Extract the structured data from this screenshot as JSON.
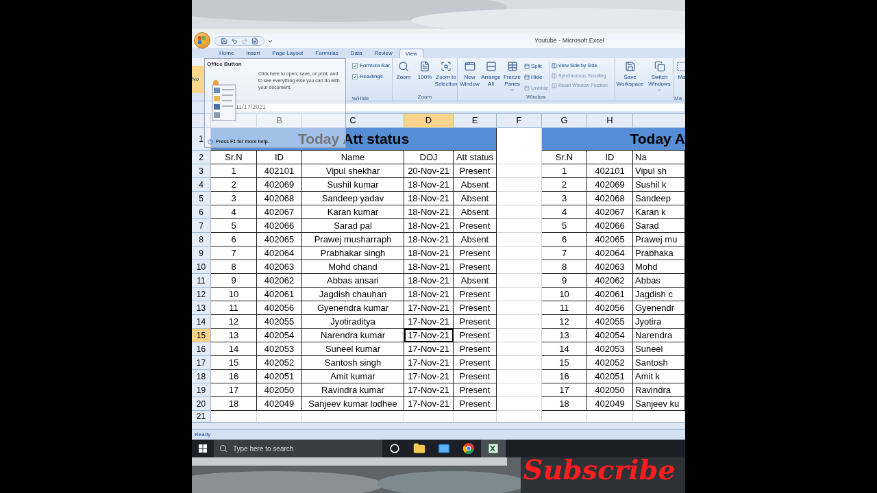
{
  "window": {
    "title": "Youtube - Microsoft Excel"
  },
  "tabs": [
    {
      "label": "Home",
      "selected": false
    },
    {
      "label": "Insert",
      "selected": false
    },
    {
      "label": "Page Layout",
      "selected": false
    },
    {
      "label": "Formulas",
      "selected": false
    },
    {
      "label": "Data",
      "selected": false
    },
    {
      "label": "Review",
      "selected": false
    },
    {
      "label": "View",
      "selected": true
    }
  ],
  "ribbon": {
    "workbook_views": {
      "button": "No"
    },
    "show_hide": {
      "label": "w/Hide",
      "checkboxes": [
        {
          "label": "Formula Bar",
          "checked": true
        },
        {
          "label": "Headings",
          "checked": true
        }
      ]
    },
    "zoom": {
      "label": "Zoom",
      "buttons": [
        "Zoom",
        "100%",
        "Zoom to Selection"
      ]
    },
    "window_group": {
      "label": "Window",
      "large_buttons": [
        {
          "label": "New Window",
          "dropdown": false
        },
        {
          "label": "Arrange All",
          "dropdown": false
        },
        {
          "label": "Freeze Panes",
          "dropdown": true
        }
      ],
      "small_buttons": [
        {
          "label": "Split",
          "disabled": false
        },
        {
          "label": "Hide",
          "disabled": false
        },
        {
          "label": "Unhide",
          "disabled": true
        }
      ],
      "side_buttons": [
        {
          "label": "View Side by Side",
          "disabled": false
        },
        {
          "label": "Synchronous Scrolling",
          "disabled": true
        },
        {
          "label": "Reset Window Position",
          "disabled": true
        }
      ],
      "large_buttons_2": [
        {
          "label": "Save Workspace",
          "dropdown": false
        },
        {
          "label": "Switch Windows",
          "dropdown": true
        }
      ]
    },
    "macros_group": {
      "button": "Ma",
      "label": "Ma"
    }
  },
  "tooltip": {
    "title": "Office Button",
    "text": "Click here to open, save, or print, and to see everything else you can do with your document.",
    "help": "Press F1 for more help."
  },
  "formula_bar": {
    "value": "11/17/2021"
  },
  "columns": [
    {
      "label": "B",
      "selected": false
    },
    {
      "label": "C",
      "selected": false
    },
    {
      "label": "D",
      "selected": true
    },
    {
      "label": "E",
      "selected": false
    },
    {
      "label": "F",
      "selected": false
    },
    {
      "label": "G",
      "selected": false
    },
    {
      "label": "H",
      "selected": false
    }
  ],
  "row_headers": [
    {
      "label": "1",
      "selected": false
    },
    {
      "label": "2",
      "selected": false
    },
    {
      "label": "3",
      "selected": false
    },
    {
      "label": "4",
      "selected": false
    },
    {
      "label": "5",
      "selected": false
    },
    {
      "label": "6",
      "selected": false
    },
    {
      "label": "7",
      "selected": false
    },
    {
      "label": "8",
      "selected": false
    },
    {
      "label": "9",
      "selected": false
    },
    {
      "label": "10",
      "selected": false
    },
    {
      "label": "11",
      "selected": false
    },
    {
      "label": "12",
      "selected": false
    },
    {
      "label": "13",
      "selected": false
    },
    {
      "label": "14",
      "selected": false
    },
    {
      "label": "15",
      "selected": true
    },
    {
      "label": "16",
      "selected": false
    },
    {
      "label": "17",
      "selected": false
    },
    {
      "label": "18",
      "selected": false
    },
    {
      "label": "19",
      "selected": false
    },
    {
      "label": "20",
      "selected": false
    },
    {
      "label": "21",
      "selected": false
    }
  ],
  "left_table": {
    "title": "Today Att status",
    "headers": [
      "Sr.N",
      "ID",
      "Name",
      "DOJ",
      "Att status"
    ],
    "rows": [
      [
        "1",
        "402101",
        "Vipul shekhar",
        "20-Nov-21",
        "Present"
      ],
      [
        "2",
        "402069",
        "Sushil kumar",
        "18-Nov-21",
        "Absent"
      ],
      [
        "3",
        "402068",
        "Sandeep yadav",
        "18-Nov-21",
        "Absent"
      ],
      [
        "4",
        "402067",
        "Karan kumar",
        "18-Nov-21",
        "Absent"
      ],
      [
        "5",
        "402066",
        "Sarad pal",
        "18-Nov-21",
        "Present"
      ],
      [
        "6",
        "402065",
        "Prawej musharraph",
        "18-Nov-21",
        "Absent"
      ],
      [
        "7",
        "402064",
        "Prabhakar singh",
        "18-Nov-21",
        "Present"
      ],
      [
        "8",
        "402063",
        "Mohd chand",
        "18-Nov-21",
        "Present"
      ],
      [
        "9",
        "402062",
        "Abbas ansari",
        "18-Nov-21",
        "Absent"
      ],
      [
        "10",
        "402061",
        "Jagdish chauhan",
        "18-Nov-21",
        "Present"
      ],
      [
        "11",
        "402056",
        "Gyenendra kumar",
        "17-Nov-21",
        "Present"
      ],
      [
        "12",
        "402055",
        "Jyotiraditya",
        "17-Nov-21",
        "Present"
      ],
      [
        "13",
        "402054",
        "Narendra kumar",
        "17-Nov-21",
        "Present"
      ],
      [
        "14",
        "402053",
        "Suneel kumar",
        "17-Nov-21",
        "Present"
      ],
      [
        "15",
        "402052",
        "Santosh singh",
        "17-Nov-21",
        "Present"
      ],
      [
        "16",
        "402051",
        "Amit kumar",
        "17-Nov-21",
        "Present"
      ],
      [
        "17",
        "402050",
        "Ravindra kumar",
        "17-Nov-21",
        "Present"
      ],
      [
        "18",
        "402049",
        "Sanjeev kumar lodhee",
        "17-Nov-21",
        "Present"
      ]
    ]
  },
  "right_table": {
    "title": "Today A",
    "headers": [
      "Sr.N",
      "ID",
      "Na"
    ],
    "rows": [
      [
        "1",
        "402101",
        "Vipul sh"
      ],
      [
        "2",
        "402069",
        "Sushil k"
      ],
      [
        "3",
        "402068",
        "Sandeep"
      ],
      [
        "4",
        "402067",
        "Karan k"
      ],
      [
        "5",
        "402066",
        "Sarad"
      ],
      [
        "6",
        "402065",
        "Prawej mu"
      ],
      [
        "7",
        "402064",
        "Prabhaka"
      ],
      [
        "8",
        "402063",
        "Mohd"
      ],
      [
        "9",
        "402062",
        "Abbas"
      ],
      [
        "10",
        "402061",
        "Jagdish c"
      ],
      [
        "11",
        "402056",
        "Gyenendr"
      ],
      [
        "12",
        "402055",
        "Jyotira"
      ],
      [
        "13",
        "402054",
        "Narendra"
      ],
      [
        "14",
        "402053",
        "Suneel"
      ],
      [
        "15",
        "402052",
        "Santosh"
      ],
      [
        "16",
        "402051",
        "Amit k"
      ],
      [
        "17",
        "402050",
        "Ravindra"
      ],
      [
        "18",
        "402049",
        "Sanjeev ku"
      ]
    ]
  },
  "status_bar": {
    "text": "Ready"
  },
  "taskbar": {
    "search_placeholder": "Type here to search",
    "apps": [
      {
        "kind": "cortana",
        "active": false
      },
      {
        "kind": "folder",
        "active": false
      },
      {
        "kind": "mail",
        "active": false
      },
      {
        "kind": "browser",
        "active": false
      },
      {
        "kind": "excel",
        "active": true
      }
    ]
  },
  "overlay": {
    "text": "Subscribe"
  }
}
